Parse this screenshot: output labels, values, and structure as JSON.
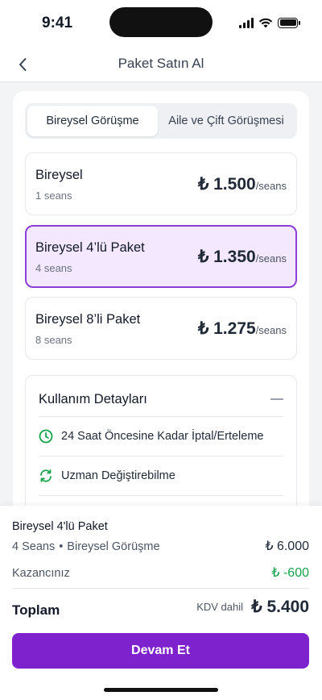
{
  "status_bar": {
    "time": "9:41"
  },
  "header": {
    "title": "Paket Satın Al",
    "back_icon": "chevron-left-icon"
  },
  "tabs": [
    {
      "label": "Bireysel Görüşme",
      "active": true
    },
    {
      "label": "Aile ve Çift Görüşmesi",
      "active": false
    }
  ],
  "packages": [
    {
      "name": "Bireysel",
      "sessions": "1 seans",
      "price": "₺ 1.500",
      "unit": "/seans",
      "selected": false
    },
    {
      "name": "Bireysel 4’lü Paket",
      "sessions": "4 seans",
      "price": "₺ 1.350",
      "unit": "/seans",
      "selected": true
    },
    {
      "name": "Bireysel 8’li Paket",
      "sessions": "8 seans",
      "price": "₺ 1.275",
      "unit": "/seans",
      "selected": false
    }
  ],
  "details": {
    "title": "Kullanım Detayları",
    "features": [
      {
        "icon": "clock-icon",
        "text": "24 Saat Öncesine Kadar İptal/Erteleme"
      },
      {
        "icon": "refresh-icon",
        "text": "Uzman Değiştirebilme"
      }
    ]
  },
  "summary": {
    "package": "Bireysel 4'lü Paket",
    "sessions": "4 Seans",
    "bullet": "•",
    "type": "Bireysel Görüşme",
    "price": "₺ 6.000",
    "savings_label": "Kazancınız",
    "savings_value": "₺ -600",
    "total_label": "Toplam",
    "kdv_label": "KDV dahil",
    "total_value": "₺ 5.400",
    "cta_label": "Devam Et"
  },
  "colors": {
    "accent": "#7e22ce",
    "selected_border": "#8b3fd6",
    "selected_bg": "#f3e8ff",
    "success": "#16a34a"
  }
}
